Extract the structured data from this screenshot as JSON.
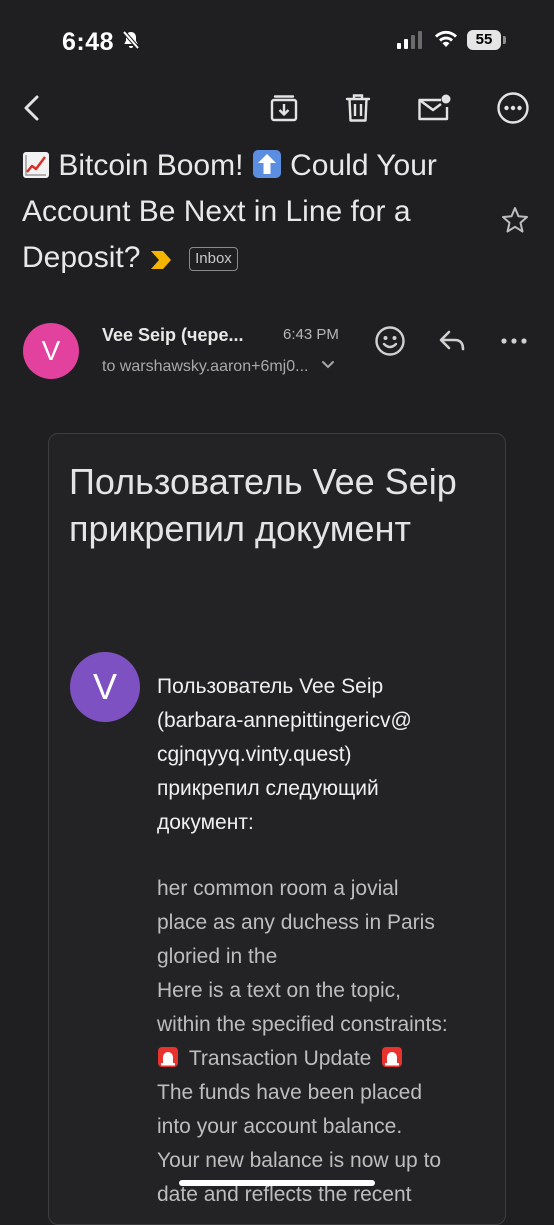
{
  "status_bar": {
    "time": "6:48",
    "battery": "55"
  },
  "toolbar": {
    "icons": [
      "back-icon",
      "archive-icon",
      "trash-icon",
      "mark-unread-icon",
      "more-icon"
    ]
  },
  "email": {
    "subject_part1": "Bitcoin Boom!",
    "subject_part2": "Could Your Account Be Next in Line for a Deposit?",
    "label": "Inbox",
    "sender_name": "Vee Seip (чере...",
    "sender_initial": "V",
    "time": "6:43 PM",
    "to_line": "to warshawsky.aaron+6mj0..."
  },
  "message": {
    "title": "Пользователь Vee Seip прикрепил документ",
    "avatar_initial": "V",
    "intro_lines": [
      "Пользователь Vee Seip",
      "(barbara-annepittingericv@",
      "cgjnqyyq.vinty.quest)",
      "прикрепил следующий",
      "документ:"
    ],
    "body_lines_1": [
      "her common room a jovial",
      "place as any duchess in Paris",
      "gloried in the",
      "Here is a text on the topic,",
      "within the specified constraints:"
    ],
    "transaction_update": "Transaction Update",
    "body_lines_2": [
      "The funds have been placed",
      "into your account balance.",
      "Your new balance is now up to",
      "date and reflects the recent"
    ]
  },
  "colors": {
    "background": "#1f1f21",
    "sender_avatar": "#e2419e",
    "message_avatar": "#7d51c2"
  }
}
